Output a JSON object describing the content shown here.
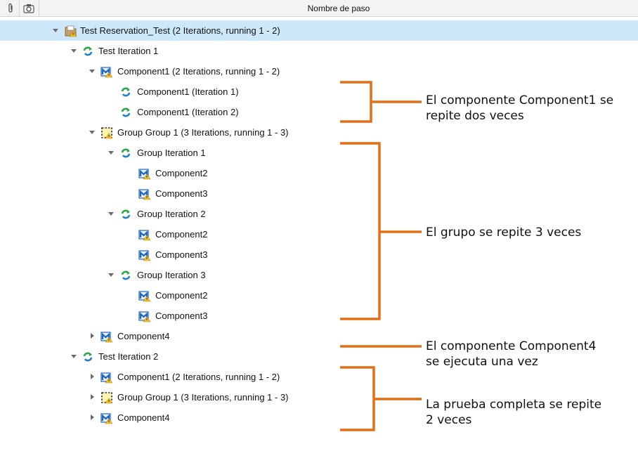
{
  "header": {
    "column_title": "Nombre de paso",
    "attachment_icon": "paperclip-icon",
    "snapshot_icon": "camera-icon"
  },
  "tree": {
    "r0": "Test Reservation_Test (2 Iterations, running 1 - 2)",
    "r1": "Test Iteration 1",
    "r2": "Component1 (2 Iterations, running 1 - 2)",
    "r3": "Component1 (Iteration 1)",
    "r4": "Component1 (Iteration 2)",
    "r5": "Group Group 1 (3 Iterations, running 1 - 3)",
    "r6": "Group Iteration 1",
    "r7": "Component2",
    "r8": "Component3",
    "r9": "Group Iteration 2",
    "r10": "Component2",
    "r11": "Component3",
    "r12": "Group Iteration 3",
    "r13": "Component2",
    "r14": "Component3",
    "r15": "Component4",
    "r16": "Test Iteration 2",
    "r17": "Component1 (2 Iterations, running 1 - 2)",
    "r18": "Group Group 1 (3 Iterations, running 1 - 3)",
    "r19": "Component4"
  },
  "annotations": {
    "a1_line1": "El componente Component1 se",
    "a1_line2": "repite dos veces",
    "a2": "El grupo se repite 3 veces",
    "a3_line1": "El componente Component4",
    "a3_line2": "se ejecuta una vez",
    "a4_line1": "La prueba completa se repite",
    "a4_line2": "2 veces"
  },
  "colors": {
    "selected_row": "#cde8f8",
    "annotation_bracket": "#e06f17",
    "iteration_icon": "#27a844",
    "component_icon": "#1e66c0"
  }
}
